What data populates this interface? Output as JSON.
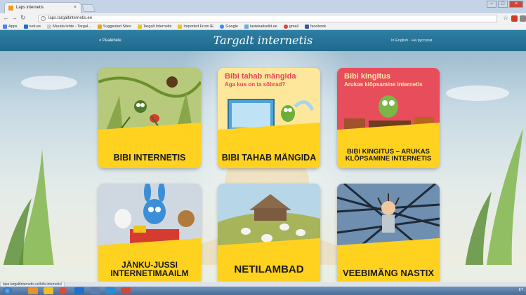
{
  "browser": {
    "tab_title": "Laps internetis",
    "tab_close": "×",
    "url": "laps.targaltinternetis.ee",
    "status_url": "laps.targaltinternetis.ee/bibi-internetis/",
    "bookmarks": [
      {
        "label": "Apps",
        "color": "#4285f4"
      },
      {
        "label": "neti.ee",
        "color": "#1f6fd1"
      },
      {
        "label": "Muuda lehte - Targal...",
        "color": "#cccccc"
      },
      {
        "label": "Suggested Sites",
        "color": "#e8a317"
      },
      {
        "label": "Targalt Internetis",
        "color": "#f0c020"
      },
      {
        "label": "Imported From IE",
        "color": "#f0c020"
      },
      {
        "label": "Google",
        "color": "#4285f4"
      },
      {
        "label": "lastekaitseliit.ee",
        "color": "#6fa8dc"
      },
      {
        "label": "gmail",
        "color": "#d44638"
      },
      {
        "label": "facebook",
        "color": "#3b5998"
      }
    ]
  },
  "page": {
    "back_link": "« Pealehele",
    "logo": "Targalt internetis",
    "lang_en": "In English",
    "lang_ru": "На русском",
    "cards": [
      {
        "title": "BIBI INTERNETIS"
      },
      {
        "title": "BIBI TAHAB MÄNGIDA",
        "subtitle1": "Bibi tahab mängida",
        "subtitle2": "Aga kus on ta sõbrad?"
      },
      {
        "title": "BIBI KINGITUS – ARUKAS KLÕPSAMINE INTERNETIS",
        "subtitle1": "Bibi kingitus",
        "subtitle2": "Arukas klõpsamine internetis"
      },
      {
        "title": "JÄNKU-JUSSI INTERNETIMAAILM"
      },
      {
        "title": "NETILAMBAD"
      },
      {
        "title": "VEEBIMÄNG NASTIX"
      }
    ]
  },
  "taskbar": {
    "tray_text": "ET"
  }
}
